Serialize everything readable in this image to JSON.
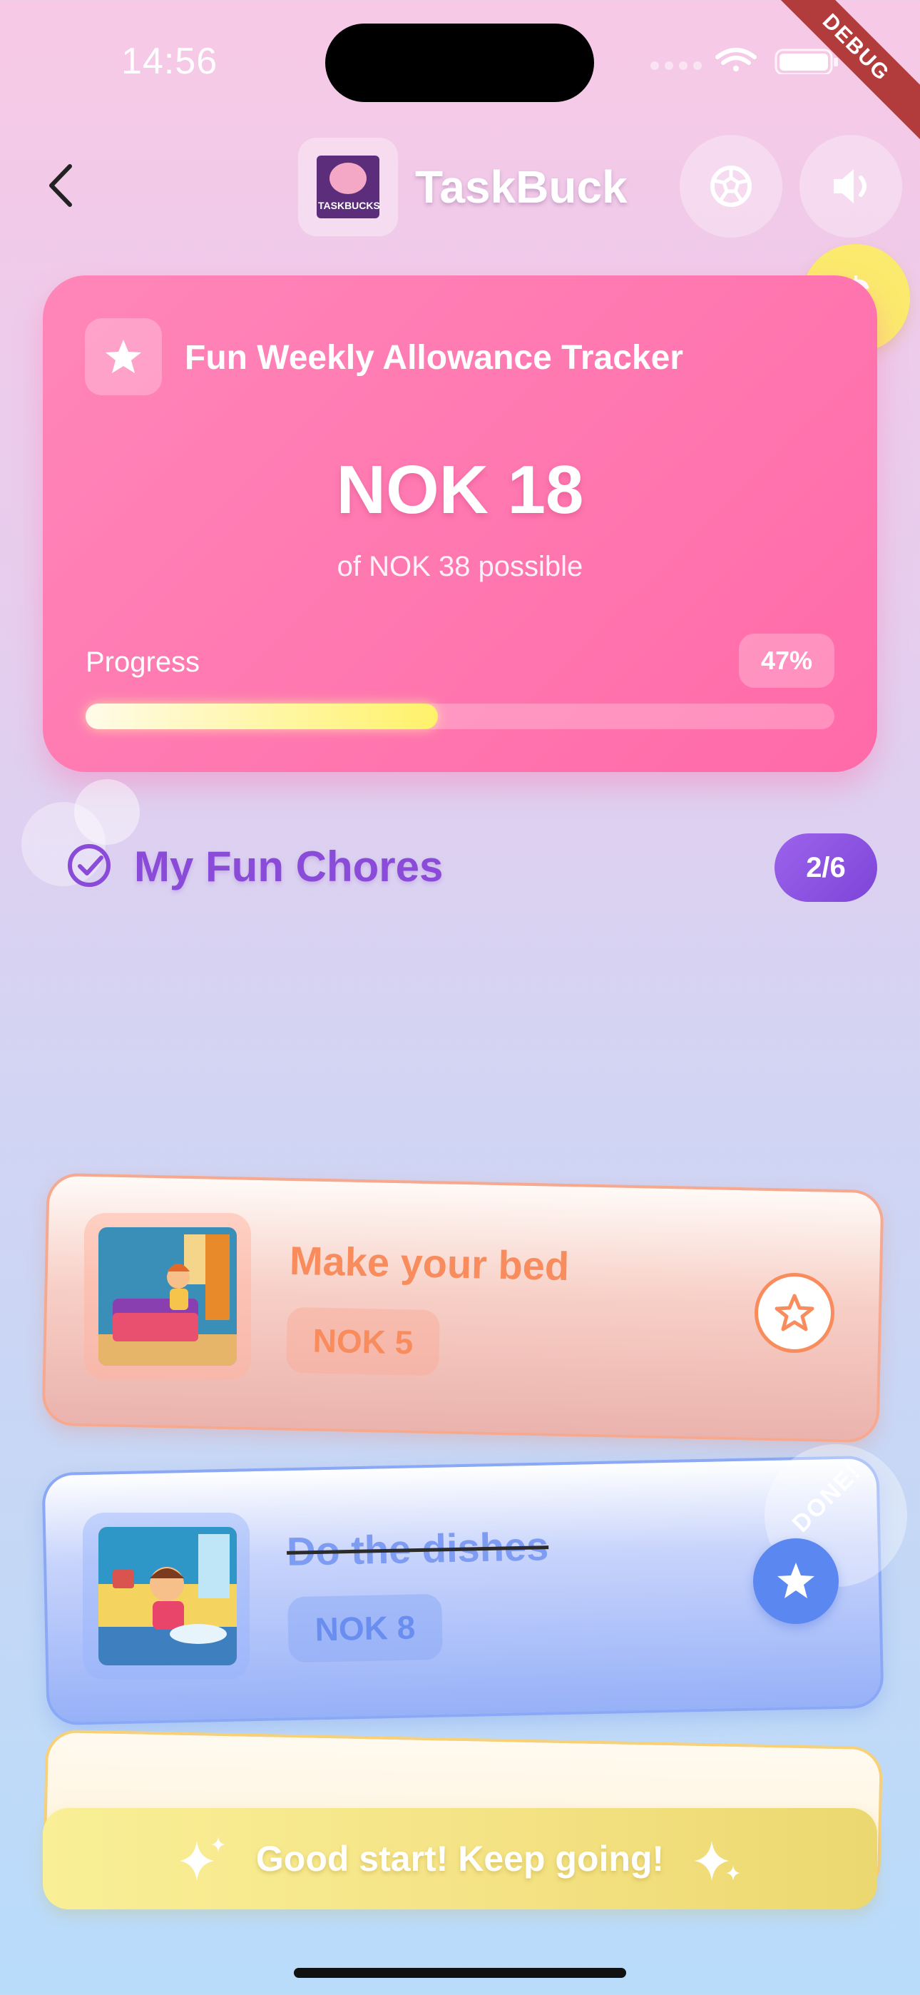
{
  "status_bar": {
    "time": "14:56",
    "debug_label": "DEBUG"
  },
  "header": {
    "back_icon": "chevron-left-icon",
    "logo_text": "TASKBUCKS",
    "app_name": "TaskBuck",
    "settings_icon": "soccer-ball-icon",
    "sound_icon": "speaker-icon",
    "currency_badge_icon": "dollar-icon",
    "currency_symbol": "$"
  },
  "allowance_card": {
    "title": "Fun Weekly Allowance Tracker",
    "amount": "NOK 18",
    "possible": "of NOK 38 possible",
    "progress_label": "Progress",
    "progress_percent_label": "47%",
    "progress_fraction": 0.47
  },
  "chores_section": {
    "title": "My Fun Chores",
    "count": "2/6"
  },
  "chores": [
    {
      "title": "Make your bed",
      "price": "NOK 5",
      "done": false,
      "color": "#f98c5d"
    },
    {
      "title": "Do the dishes",
      "price": "NOK 8",
      "done": true,
      "done_label": "DONE!",
      "color": "#7d9cf2"
    }
  ],
  "encouragement": {
    "text": "Good start! Keep going!"
  },
  "colors": {
    "accent_pink": "#ff6aa8",
    "accent_purple": "#8a4bd8",
    "accent_yellow": "#fbea6d"
  }
}
